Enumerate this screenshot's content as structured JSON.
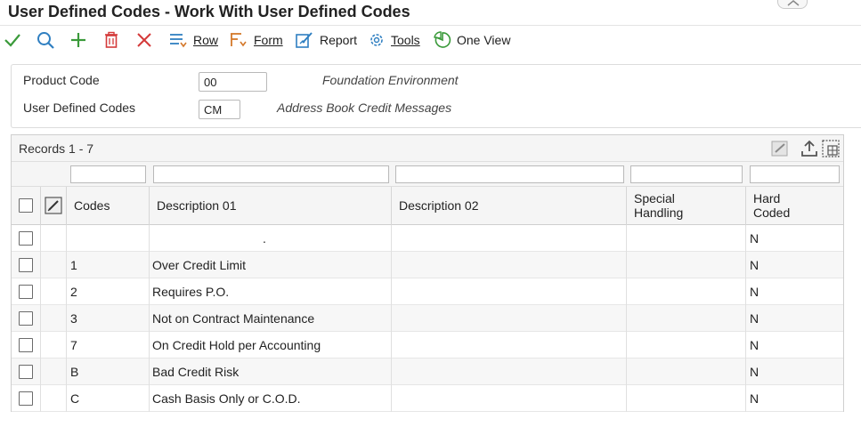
{
  "title": "User Defined Codes - Work With User Defined Codes",
  "toolbar": {
    "select_icon": "checkmark-icon",
    "find_icon": "search-icon",
    "add_icon": "plus-icon",
    "delete_icon": "trash-icon",
    "close_icon": "close-icon",
    "row_label": "Row",
    "form_label": "Form",
    "report_label": "Report",
    "tools_label": "Tools",
    "oneview_label": "One View"
  },
  "header": {
    "product_code_label": "Product Code",
    "product_code_value": "00",
    "product_code_desc": "Foundation Environment",
    "udc_label": "User Defined Codes",
    "udc_value": "CM",
    "udc_desc": "Address Book Credit Messages"
  },
  "grid": {
    "records_text": "Records 1 - 7",
    "columns": [
      "Codes",
      "Description 01",
      "Description 02",
      "Special Handling",
      "Hard Coded"
    ],
    "special_handling_lines": [
      "Special",
      "Handling"
    ],
    "hard_coded_lines": [
      "Hard",
      "Coded"
    ],
    "rows": [
      {
        "code": "",
        "desc1": ".",
        "desc2": "",
        "special": "",
        "hard": "N"
      },
      {
        "code": "1",
        "desc1": "Over Credit Limit",
        "desc2": "",
        "special": "",
        "hard": "N"
      },
      {
        "code": "2",
        "desc1": "Requires P.O.",
        "desc2": "",
        "special": "",
        "hard": "N"
      },
      {
        "code": "3",
        "desc1": "Not on Contract Maintenance",
        "desc2": "",
        "special": "",
        "hard": "N"
      },
      {
        "code": "7",
        "desc1": "On Credit Hold per Accounting",
        "desc2": "",
        "special": "",
        "hard": "N"
      },
      {
        "code": "B",
        "desc1": "Bad Credit Risk",
        "desc2": "",
        "special": "",
        "hard": "N"
      },
      {
        "code": "C",
        "desc1": "Cash Basis Only or C.O.D.",
        "desc2": "",
        "special": "",
        "hard": "N"
      }
    ]
  },
  "colors": {
    "accent_green": "#3a9a3a",
    "accent_blue": "#2f7fc1",
    "accent_red": "#d43a3a"
  }
}
